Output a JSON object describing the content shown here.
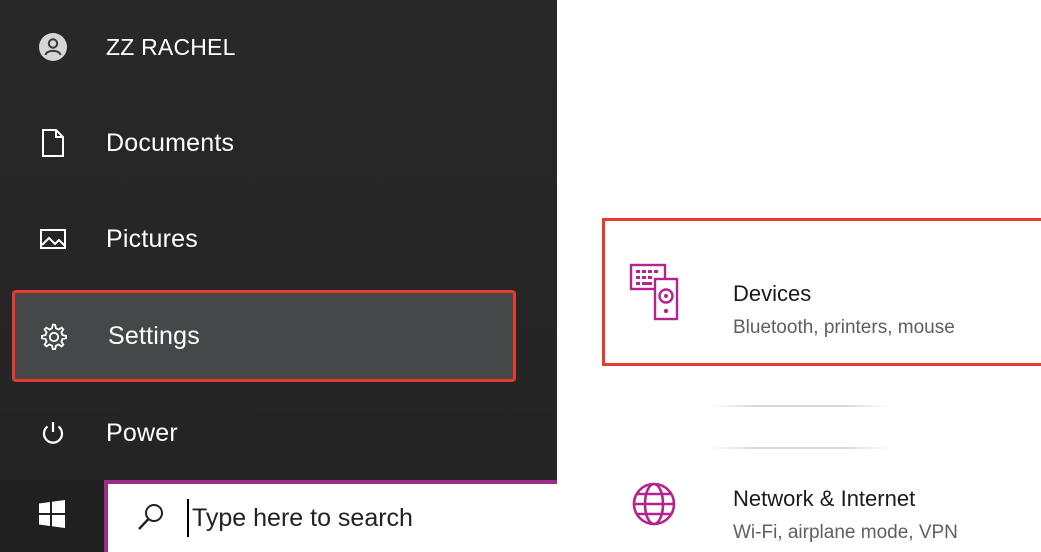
{
  "start_menu": {
    "user": {
      "name": "ZZ RACHEL",
      "icon": "user-avatar-icon"
    },
    "items": [
      {
        "label": "Documents",
        "icon": "document-icon"
      },
      {
        "label": "Pictures",
        "icon": "pictures-icon"
      },
      {
        "label": "Settings",
        "icon": "gear-icon",
        "highlighted": true
      },
      {
        "label": "Power",
        "icon": "power-icon"
      }
    ],
    "highlight_color": "#e8392c"
  },
  "taskbar": {
    "start_icon": "windows-logo-icon",
    "search": {
      "icon": "search-icon",
      "placeholder": "Type here to search"
    },
    "accent_color": "#9c2d8a"
  },
  "settings": {
    "tiles": [
      {
        "title": "Devices",
        "subtitle": "Bluetooth, printers, mouse",
        "icon": "devices-icon",
        "highlighted": true
      },
      {
        "title": "Network & Internet",
        "subtitle": "Wi-Fi, airplane mode, VPN",
        "icon": "globe-icon"
      }
    ],
    "icon_color": "#b5238c"
  }
}
